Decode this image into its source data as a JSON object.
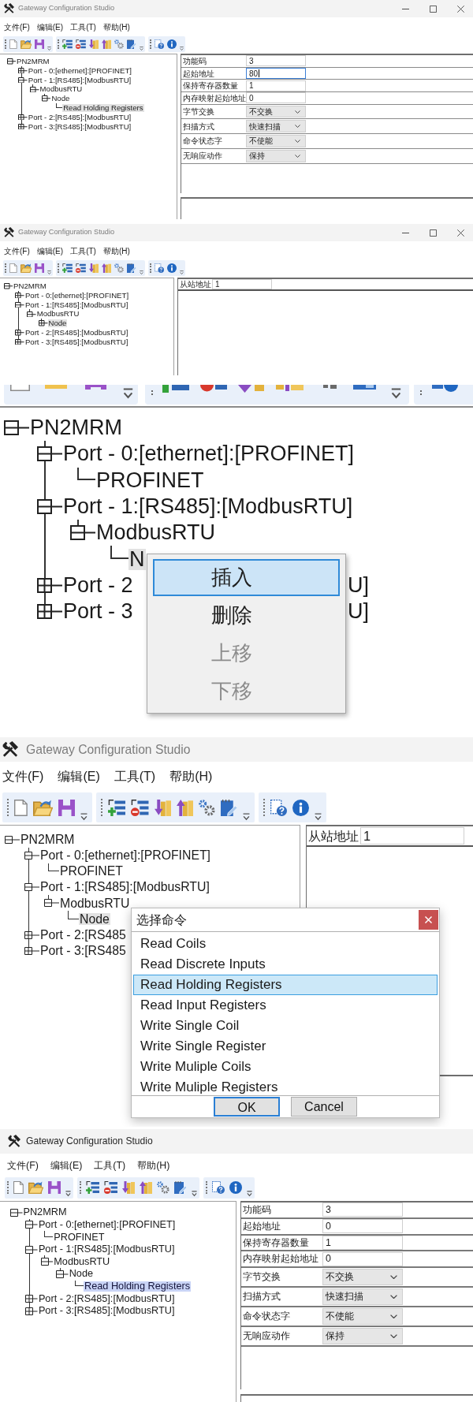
{
  "screenshots": [
    {
      "kind": "window",
      "title": "Gateway Configuration Studio",
      "active": false,
      "window_controls": true,
      "menu": [
        "文件(F)",
        "编辑(E)",
        "工具(T)",
        "帮助(H)"
      ],
      "tree_focused": false,
      "tree": [
        {
          "label": "PN2MRM",
          "expanded": true,
          "selected": false,
          "children": [
            {
              "label": "Port - 0:[ethernet]:[PROFINET]",
              "expanded": false,
              "selected": false
            },
            {
              "label": "Port - 1:[RS485]:[ModbusRTU]",
              "expanded": true,
              "selected": false,
              "children": [
                {
                  "label": "ModbusRTU",
                  "expanded": true,
                  "selected": false,
                  "children": [
                    {
                      "label": "Node",
                      "expanded": true,
                      "selected": false,
                      "children": [
                        {
                          "label": "Read Holding Registers",
                          "selected": true
                        }
                      ]
                    }
                  ]
                }
              ]
            },
            {
              "label": "Port - 2:[RS485]:[ModbusRTU]",
              "expanded": false,
              "selected": false
            },
            {
              "label": "Port - 3:[RS485]:[ModbusRTU]",
              "expanded": false,
              "selected": false
            }
          ]
        }
      ],
      "properties": [
        {
          "label": "功能码",
          "kind": "text",
          "value": "3",
          "focused": false
        },
        {
          "label": "起始地址",
          "kind": "text",
          "value": "80",
          "focused": true
        },
        {
          "label": "保持寄存器数量",
          "kind": "text",
          "value": "1",
          "focused": false
        },
        {
          "label": "内存映射起始地址",
          "kind": "text",
          "value": "0",
          "focused": false
        },
        {
          "label": "字节交换",
          "kind": "combo",
          "value": "不交换",
          "focused": false
        },
        {
          "label": "扫描方式",
          "kind": "combo",
          "value": "快速扫描",
          "focused": false
        },
        {
          "label": "命令状态字",
          "kind": "combo",
          "value": "不使能",
          "focused": false
        },
        {
          "label": "无响应动作",
          "kind": "combo",
          "value": "保持",
          "focused": false
        }
      ]
    },
    {
      "kind": "window",
      "title": "Gateway Configuration Studio",
      "active": false,
      "window_controls": true,
      "menu": [
        "文件(F)",
        "编辑(E)",
        "工具(T)",
        "帮助(H)"
      ],
      "tree_focused": false,
      "tree": [
        {
          "label": "PN2MRM",
          "expanded": true,
          "selected": false,
          "children": [
            {
              "label": "Port - 0:[ethernet]:[PROFINET]",
              "expanded": false,
              "selected": false
            },
            {
              "label": "Port - 1:[RS485]:[ModbusRTU]",
              "expanded": true,
              "selected": false,
              "children": [
                {
                  "label": "ModbusRTU",
                  "expanded": true,
                  "selected": false,
                  "children": [
                    {
                      "label": "Node",
                      "expanded": false,
                      "selected": true
                    }
                  ]
                }
              ]
            },
            {
              "label": "Port - 2:[RS485]:[ModbusRTU]",
              "expanded": false,
              "selected": false
            },
            {
              "label": "Port - 3:[RS485]:[ModbusRTU]",
              "expanded": false,
              "selected": false
            }
          ]
        }
      ],
      "properties": [
        {
          "label": "从站地址",
          "kind": "text",
          "value": "1",
          "focused": false
        }
      ]
    },
    {
      "kind": "zoomed-tree",
      "tree_focused": false,
      "tree": [
        {
          "label": "PN2MRM",
          "expanded": true,
          "selected": false,
          "children": [
            {
              "label": "Port - 0:[ethernet]:[PROFINET]",
              "expanded": true,
              "selected": false,
              "children": [
                {
                  "label": "PROFINET",
                  "selected": false
                }
              ]
            },
            {
              "label": "Port - 1:[RS485]:[ModbusRTU]",
              "expanded": true,
              "selected": false,
              "children": [
                {
                  "label": "ModbusRTU",
                  "expanded": true,
                  "selected": false,
                  "children": [
                    {
                      "label": "N",
                      "selected": true
                    }
                  ]
                }
              ]
            },
            {
              "label": "Port - 2",
              "label_end": "U]",
              "expanded": false,
              "selected": false
            },
            {
              "label": "Port - 3",
              "label_end": "U]",
              "expanded": false,
              "selected": false
            }
          ]
        }
      ],
      "context_menu": {
        "items": [
          {
            "label": "插入",
            "selected": true,
            "disabled": false
          },
          {
            "label": "删除",
            "selected": false,
            "disabled": false
          },
          {
            "label": "上移",
            "selected": false,
            "disabled": true
          },
          {
            "label": "下移",
            "selected": false,
            "disabled": true
          }
        ]
      }
    },
    {
      "kind": "window",
      "title": "Gateway Configuration Studio",
      "active": false,
      "window_controls": false,
      "menu": [
        "文件(F)",
        "编辑(E)",
        "工具(T)",
        "帮助(H)"
      ],
      "tree_focused": false,
      "tree": [
        {
          "label": "PN2MRM",
          "expanded": true,
          "selected": false,
          "children": [
            {
              "label": "Port - 0:[ethernet]:[PROFINET]",
              "expanded": true,
              "selected": false,
              "children": [
                {
                  "label": "PROFINET",
                  "selected": false
                }
              ]
            },
            {
              "label": "Port - 1:[RS485]:[ModbusRTU]",
              "expanded": true,
              "selected": false,
              "children": [
                {
                  "label": "ModbusRTU",
                  "expanded": true,
                  "selected": false,
                  "children": [
                    {
                      "label": "Node",
                      "selected": true
                    }
                  ]
                }
              ]
            },
            {
              "label": "Port - 2:[RS485",
              "expanded": false,
              "selected": false
            },
            {
              "label": "Port - 3:[RS485",
              "expanded": false,
              "selected": false
            }
          ]
        }
      ],
      "properties": [
        {
          "label": "从站地址",
          "kind": "text",
          "value": "1",
          "focused": false
        }
      ],
      "dialog": {
        "title": "选择命令",
        "items": [
          {
            "label": "Read Coils",
            "selected": false
          },
          {
            "label": "Read Discrete Inputs",
            "selected": false
          },
          {
            "label": "Read Holding Registers",
            "selected": true
          },
          {
            "label": "Read Input Registers",
            "selected": false
          },
          {
            "label": "Write Single Coil",
            "selected": false
          },
          {
            "label": "Write Single Register",
            "selected": false
          },
          {
            "label": "Write Muliple Coils",
            "selected": false
          },
          {
            "label": "Write Muliple Registers",
            "selected": false
          }
        ],
        "buttons": [
          {
            "label": "OK",
            "default": true
          },
          {
            "label": "Cancel",
            "default": false
          }
        ]
      }
    },
    {
      "kind": "window",
      "title": "Gateway Configuration Studio",
      "active": true,
      "window_controls": false,
      "menu": [
        "文件(F)",
        "编辑(E)",
        "工具(T)",
        "帮助(H)"
      ],
      "tree_focused": true,
      "tree": [
        {
          "label": "PN2MRM",
          "expanded": true,
          "selected": false,
          "children": [
            {
              "label": "Port - 0:[ethernet]:[PROFINET]",
              "expanded": true,
              "selected": false,
              "children": [
                {
                  "label": "PROFINET",
                  "selected": false
                }
              ]
            },
            {
              "label": "Port - 1:[RS485]:[ModbusRTU]",
              "expanded": true,
              "selected": false,
              "children": [
                {
                  "label": "ModbusRTU",
                  "expanded": true,
                  "selected": false,
                  "children": [
                    {
                      "label": "Node",
                      "expanded": true,
                      "selected": false,
                      "children": [
                        {
                          "label": "Read Holding Registers",
                          "selected": true
                        }
                      ]
                    }
                  ]
                }
              ]
            },
            {
              "label": "Port - 2:[RS485]:[ModbusRTU]",
              "expanded": false,
              "selected": false
            },
            {
              "label": "Port - 3:[RS485]:[ModbusRTU]",
              "expanded": false,
              "selected": false
            }
          ]
        }
      ],
      "properties": [
        {
          "label": "功能码",
          "kind": "text",
          "value": "3",
          "focused": false
        },
        {
          "label": "起始地址",
          "kind": "text",
          "value": "0",
          "focused": false
        },
        {
          "label": "保持寄存器数量",
          "kind": "text",
          "value": "1",
          "focused": false
        },
        {
          "label": "内存映射起始地址",
          "kind": "text",
          "value": "0",
          "focused": false
        },
        {
          "label": "字节交换",
          "kind": "combo",
          "value": "不交换",
          "focused": false
        },
        {
          "label": "扫描方式",
          "kind": "combo",
          "value": "快速扫描",
          "focused": false
        },
        {
          "label": "命令状态字",
          "kind": "combo",
          "value": "不使能",
          "focused": false
        },
        {
          "label": "无响应动作",
          "kind": "combo",
          "value": "保持",
          "focused": false
        }
      ]
    }
  ]
}
